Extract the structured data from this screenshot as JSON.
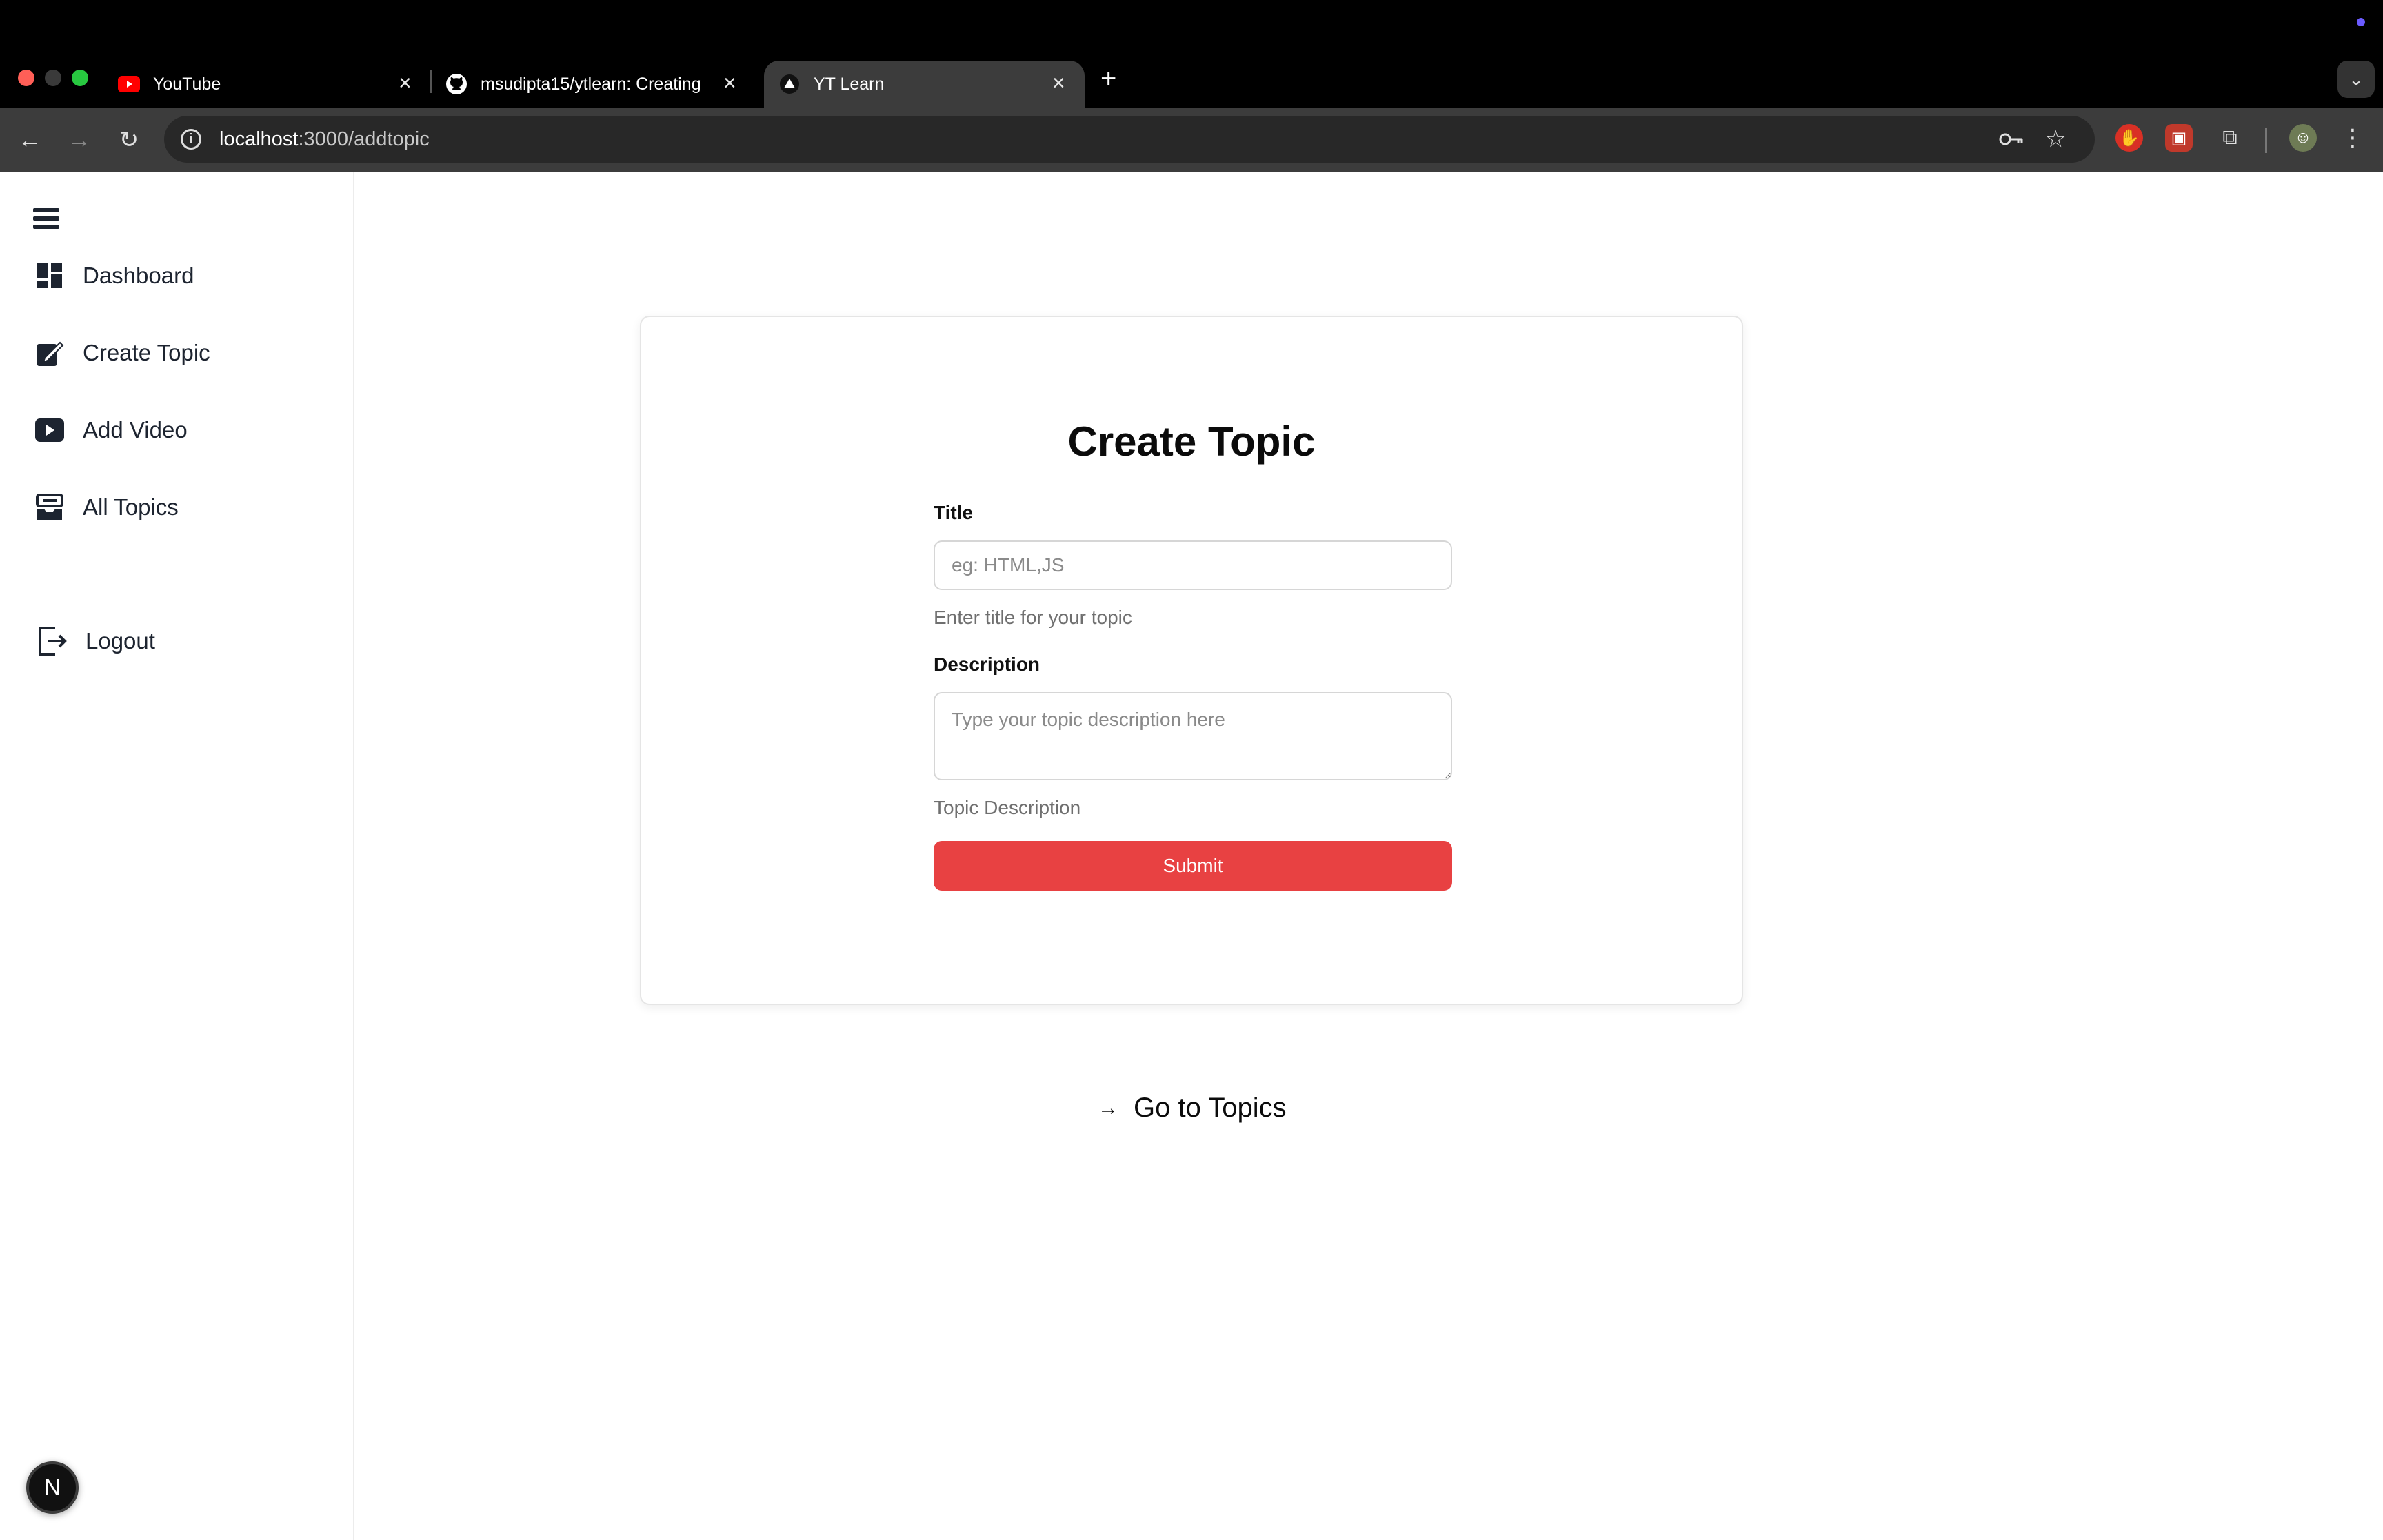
{
  "browser": {
    "tabs": [
      {
        "title": "YouTube",
        "icon": "youtube-icon"
      },
      {
        "title": "msudipta15/ytlearn: Creating",
        "icon": "github-icon"
      },
      {
        "title": "YT Learn",
        "icon": "triangle-icon",
        "active": true
      }
    ],
    "url_host": "localhost",
    "url_path": ":3000/addtopic"
  },
  "sidebar": {
    "items": [
      {
        "label": "Dashboard",
        "icon": "dashboard-icon"
      },
      {
        "label": "Create Topic",
        "icon": "edit-icon"
      },
      {
        "label": "Add Video",
        "icon": "video-icon"
      },
      {
        "label": "All Topics",
        "icon": "inbox-icon"
      },
      {
        "label": "Logout",
        "icon": "logout-icon"
      }
    ],
    "badge": "N"
  },
  "form": {
    "heading": "Create Topic",
    "title_label": "Title",
    "title_placeholder": "eg: HTML,JS",
    "title_hint": "Enter title for your topic",
    "description_label": "Description",
    "description_placeholder": "Type your topic description here",
    "description_hint": "Topic Description",
    "submit_label": "Submit"
  },
  "footer_link": {
    "label": "Go to Topics"
  },
  "colors": {
    "accent": "#e84142",
    "chrome_bg": "#3c3c3c"
  }
}
